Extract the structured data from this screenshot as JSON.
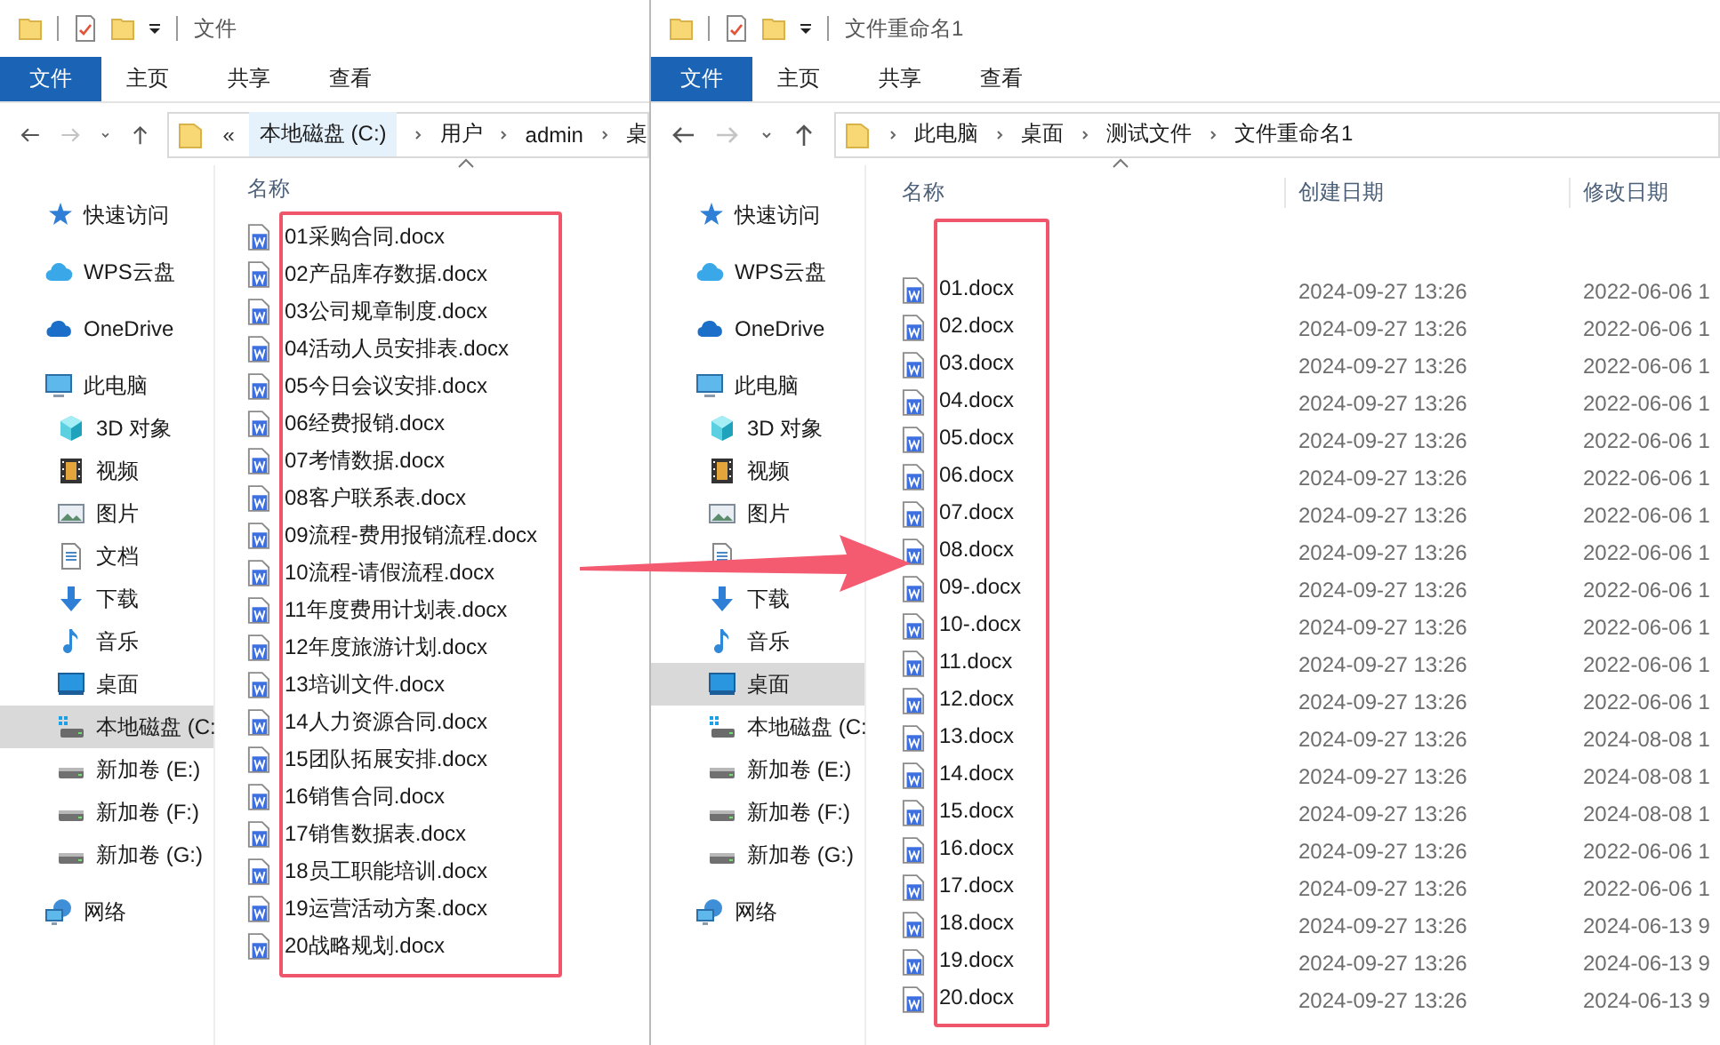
{
  "windows": [
    {
      "title": "文件",
      "ribbon_tabs": [
        {
          "label": "文件",
          "selected": true
        },
        {
          "label": "主页",
          "selected": false
        },
        {
          "label": "共享",
          "selected": false
        },
        {
          "label": "查看",
          "selected": false
        }
      ],
      "overflow_marker": "«",
      "breadcrumb": [
        "本地磁盘 (C:)",
        "用户",
        "admin",
        "桌"
      ],
      "sidebar": [
        {
          "label": "快速访问",
          "kind": "star",
          "selected": false
        },
        {
          "label": "WPS云盘",
          "kind": "wps-cloud",
          "selected": false
        },
        {
          "label": "OneDrive",
          "kind": "onedrive",
          "selected": false
        },
        {
          "label": "此电脑",
          "kind": "pc",
          "selected": false,
          "children": [
            {
              "label": "3D 对象",
              "kind": "cube",
              "selected": false
            },
            {
              "label": "视频",
              "kind": "video",
              "selected": false
            },
            {
              "label": "图片",
              "kind": "pictures",
              "selected": false
            },
            {
              "label": "文档",
              "kind": "documents",
              "selected": false
            },
            {
              "label": "下载",
              "kind": "downloads",
              "selected": false
            },
            {
              "label": "音乐",
              "kind": "music",
              "selected": false
            },
            {
              "label": "桌面",
              "kind": "desktop",
              "selected": false
            },
            {
              "label": "本地磁盘 (C:",
              "kind": "system-drive",
              "selected": true
            },
            {
              "label": "新加卷 (E:)",
              "kind": "drive",
              "selected": false
            },
            {
              "label": "新加卷 (F:)",
              "kind": "drive",
              "selected": false
            },
            {
              "label": "新加卷 (G:)",
              "kind": "drive",
              "selected": false
            }
          ]
        },
        {
          "label": "网络",
          "kind": "network",
          "selected": false
        }
      ],
      "columns": [
        "名称"
      ],
      "files": [
        {
          "name": "01采购合同.docx"
        },
        {
          "name": "02产品库存数据.docx"
        },
        {
          "name": "03公司规章制度.docx"
        },
        {
          "name": "04活动人员安排表.docx"
        },
        {
          "name": "05今日会议安排.docx"
        },
        {
          "name": "06经费报销.docx"
        },
        {
          "name": "07考情数据.docx"
        },
        {
          "name": "08客户联系表.docx"
        },
        {
          "name": "09流程-费用报销流程.docx"
        },
        {
          "name": "10流程-请假流程.docx"
        },
        {
          "name": "11年度费用计划表.docx"
        },
        {
          "name": "12年度旅游计划.docx"
        },
        {
          "name": "13培训文件.docx"
        },
        {
          "name": "14人力资源合同.docx"
        },
        {
          "name": "15团队拓展安排.docx"
        },
        {
          "name": "16销售合同.docx"
        },
        {
          "name": "17销售数据表.docx"
        },
        {
          "name": "18员工职能培训.docx"
        },
        {
          "name": "19运营活动方案.docx"
        },
        {
          "name": "20战略规划.docx"
        }
      ]
    },
    {
      "title": "文件重命名1",
      "ribbon_tabs": [
        {
          "label": "文件",
          "selected": true
        },
        {
          "label": "主页",
          "selected": false
        },
        {
          "label": "共享",
          "selected": false
        },
        {
          "label": "查看",
          "selected": false
        }
      ],
      "breadcrumb": [
        "此电脑",
        "桌面",
        "测试文件",
        "文件重命名1"
      ],
      "sidebar": [
        {
          "label": "快速访问",
          "kind": "star",
          "selected": false
        },
        {
          "label": "WPS云盘",
          "kind": "wps-cloud",
          "selected": false
        },
        {
          "label": "OneDrive",
          "kind": "onedrive",
          "selected": false
        },
        {
          "label": "此电脑",
          "kind": "pc",
          "selected": false,
          "children": [
            {
              "label": "3D 对象",
              "kind": "cube",
              "selected": false
            },
            {
              "label": "视频",
              "kind": "video",
              "selected": false
            },
            {
              "label": "图片",
              "kind": "pictures",
              "selected": false
            },
            {
              "kind": "documents",
              "selected": false
            },
            {
              "label": "下载",
              "kind": "downloads",
              "selected": false
            },
            {
              "label": "音乐",
              "kind": "music",
              "selected": false
            },
            {
              "label": "桌面",
              "kind": "desktop",
              "selected": true
            },
            {
              "label": "本地磁盘 (C:",
              "kind": "system-drive",
              "selected": false
            },
            {
              "label": "新加卷 (E:)",
              "kind": "drive",
              "selected": false
            },
            {
              "label": "新加卷 (F:)",
              "kind": "drive",
              "selected": false
            },
            {
              "label": "新加卷 (G:)",
              "kind": "drive",
              "selected": false
            }
          ]
        },
        {
          "label": "网络",
          "kind": "network",
          "selected": false
        }
      ],
      "columns": [
        "名称",
        "创建日期",
        "修改日期"
      ],
      "files": [
        {
          "name": "01.docx",
          "created": "2024-09-27 13:26",
          "modified": "2022-06-06 1"
        },
        {
          "name": "02.docx",
          "created": "2024-09-27 13:26",
          "modified": "2022-06-06 1"
        },
        {
          "name": "03.docx",
          "created": "2024-09-27 13:26",
          "modified": "2022-06-06 1"
        },
        {
          "name": "04.docx",
          "created": "2024-09-27 13:26",
          "modified": "2022-06-06 1"
        },
        {
          "name": "05.docx",
          "created": "2024-09-27 13:26",
          "modified": "2022-06-06 1"
        },
        {
          "name": "06.docx",
          "created": "2024-09-27 13:26",
          "modified": "2022-06-06 1"
        },
        {
          "name": "07.docx",
          "created": "2024-09-27 13:26",
          "modified": "2022-06-06 1"
        },
        {
          "name": "08.docx",
          "created": "2024-09-27 13:26",
          "modified": "2022-06-06 1"
        },
        {
          "name": "09-.docx",
          "created": "2024-09-27 13:26",
          "modified": "2022-06-06 1"
        },
        {
          "name": "10-.docx",
          "created": "2024-09-27 13:26",
          "modified": "2022-06-06 1"
        },
        {
          "name": "11.docx",
          "created": "2024-09-27 13:26",
          "modified": "2022-06-06 1"
        },
        {
          "name": "12.docx",
          "created": "2024-09-27 13:26",
          "modified": "2022-06-06 1"
        },
        {
          "name": "13.docx",
          "created": "2024-09-27 13:26",
          "modified": "2024-08-08 1"
        },
        {
          "name": "14.docx",
          "created": "2024-09-27 13:26",
          "modified": "2024-08-08 1"
        },
        {
          "name": "15.docx",
          "created": "2024-09-27 13:26",
          "modified": "2024-08-08 1"
        },
        {
          "name": "16.docx",
          "created": "2024-09-27 13:26",
          "modified": "2022-06-06 1"
        },
        {
          "name": "17.docx",
          "created": "2024-09-27 13:26",
          "modified": "2022-06-06 1"
        },
        {
          "name": "18.docx",
          "created": "2024-09-27 13:26",
          "modified": "2024-06-13 9"
        },
        {
          "name": "19.docx",
          "created": "2024-09-27 13:26",
          "modified": "2024-06-13 9"
        },
        {
          "name": "20.docx",
          "created": "2024-09-27 13:26",
          "modified": "2024-06-13 9"
        }
      ]
    }
  ]
}
